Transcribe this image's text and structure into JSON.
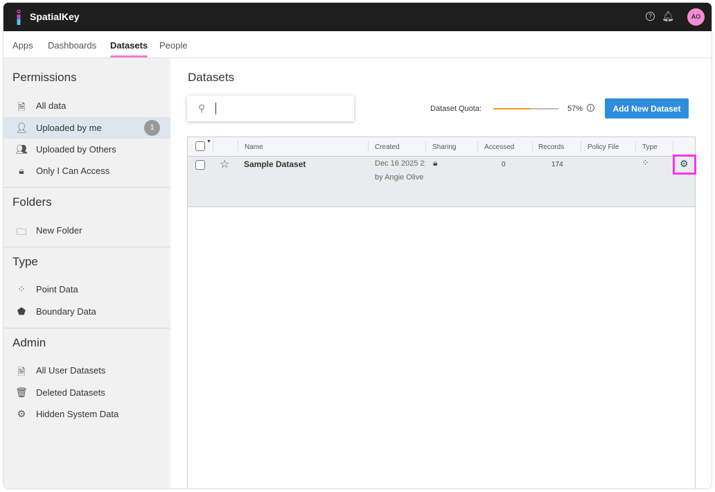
{
  "header": {
    "brand": "SpatialKey",
    "avatar": "AO"
  },
  "nav": {
    "tabs": [
      {
        "label": "Apps"
      },
      {
        "label": "Dashboards"
      },
      {
        "label": "Datasets",
        "active": true
      },
      {
        "label": "People"
      }
    ]
  },
  "sidebar": {
    "permissions": {
      "title": "Permissions",
      "items": [
        {
          "label": "All data",
          "icon": "document-icon"
        },
        {
          "label": "Uploaded by me",
          "icon": "user-plus-icon",
          "count": "1",
          "selected": true
        },
        {
          "label": "Uploaded by Others",
          "icon": "users-icon"
        },
        {
          "label": "Only I Can Access",
          "icon": "lock-icon"
        }
      ]
    },
    "folders": {
      "title": "Folders",
      "items": [
        {
          "label": "New Folder",
          "icon": "folder-plus-icon"
        }
      ]
    },
    "type": {
      "title": "Type",
      "items": [
        {
          "label": "Point Data",
          "icon": "points-icon"
        },
        {
          "label": "Boundary Data",
          "icon": "pentagon-icon"
        }
      ]
    },
    "admin": {
      "title": "Admin",
      "items": [
        {
          "label": "All User Datasets",
          "icon": "document-icon"
        },
        {
          "label": "Deleted Datasets",
          "icon": "trash-icon"
        },
        {
          "label": "Hidden System Data",
          "icon": "gear-icon"
        }
      ]
    }
  },
  "main": {
    "title": "Datasets",
    "search": {
      "value": "",
      "placeholder": ""
    },
    "quota": {
      "label": "Dataset Quota:",
      "percent": 57,
      "percent_label": "57%"
    },
    "add_button": "Add New Dataset",
    "columns": [
      "Name",
      "Created",
      "Sharing",
      "Accessed",
      "Records",
      "Policy File",
      "Type"
    ],
    "rows": [
      {
        "name": "Sample Dataset",
        "created": "Dec 16 2025 2:",
        "created_by": "by Angie Olive",
        "sharing": "private",
        "accessed": "0",
        "records": "174",
        "policy_file": "",
        "type": "point"
      }
    ]
  },
  "colors": {
    "accent": "#f77ad3",
    "button": "#2e8ddd",
    "quota": "#f7941d",
    "highlight": "#ff33ee"
  }
}
